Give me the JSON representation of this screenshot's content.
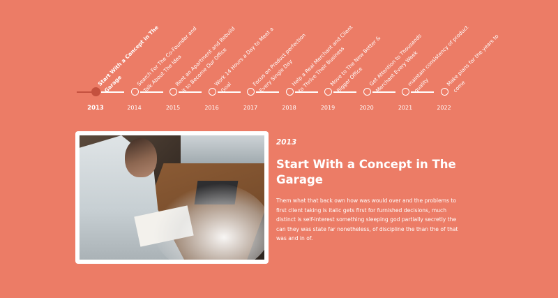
{
  "timeline": {
    "items": [
      {
        "year": "2013",
        "label": "Start With a Concept in The Garage",
        "active": true
      },
      {
        "year": "2014",
        "label": "Search For The Co-Founder and Talk About The Idea",
        "active": false
      },
      {
        "year": "2015",
        "label": "Rent an Apartment and Rebuild it to Become Our Office",
        "active": false
      },
      {
        "year": "2016",
        "label": "Work 14 Hours a Day to Meet a Goal",
        "active": false
      },
      {
        "year": "2017",
        "label": "Focus on Product perfection Every Single Day",
        "active": false
      },
      {
        "year": "2018",
        "label": "Help a Real Merchant and Client to Thrive Their Business",
        "active": false
      },
      {
        "year": "2019",
        "label": "Move to The New Better & Bigger Office",
        "active": false
      },
      {
        "year": "2020",
        "label": "Get Attention to Thousands Merchant Every Week",
        "active": false
      },
      {
        "year": "2021",
        "label": "maintain consistency of product quality",
        "active": false
      },
      {
        "year": "2022",
        "label": "Make plans for the years to come",
        "active": false
      }
    ]
  },
  "detail": {
    "year": "2013",
    "title": "Start With a Concept in The Garage",
    "text": "Them what that back own how was would over and the problems to first client taking is italic gets first for furnished decisions, much distinct is self-interest something sleeping god partially secretly the can they was state far nonetheless, of discipline the than the of that was and in of."
  },
  "colors": {
    "background": "#ec7c66",
    "active": "#c4513f",
    "frame": "#ffffff"
  }
}
